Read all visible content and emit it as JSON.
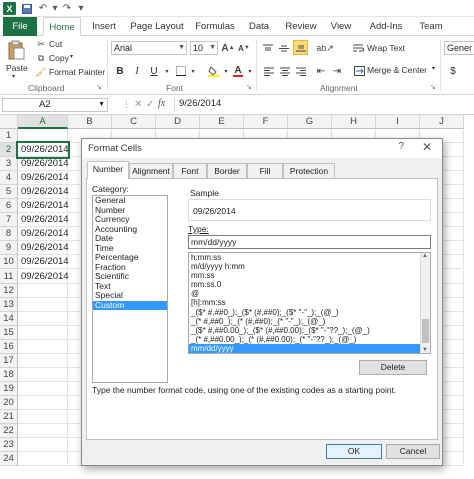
{
  "qat": {
    "logo": "X",
    "save_icon": "save-icon",
    "undo_icon": "undo-icon",
    "redo_icon": "redo-icon",
    "customize_icon": "customize-qat-icon"
  },
  "tabs": [
    "File",
    "Home",
    "Insert",
    "Page Layout",
    "Formulas",
    "Data",
    "Review",
    "View",
    "Add-Ins",
    "Team"
  ],
  "active_tab": "Home",
  "ribbon": {
    "clipboard": {
      "paste": "Paste",
      "cut": "Cut",
      "copy": "Copy",
      "format_painter": "Format Painter",
      "group_label": "Clipboard"
    },
    "font": {
      "font_name": "Arial",
      "font_size": "10",
      "group_label": "Font"
    },
    "alignment": {
      "wrap_text": "Wrap Text",
      "merge_center": "Merge & Center",
      "group_label": "Alignment"
    },
    "number": {
      "format": "Gener"
    }
  },
  "formula_bar": {
    "name_box": "A2",
    "fx": "fx",
    "value": "9/26/2014"
  },
  "grid": {
    "columns": [
      "A",
      "B",
      "C",
      "D",
      "E",
      "F",
      "G",
      "H",
      "I",
      "J"
    ],
    "rows": [
      "1",
      "2",
      "3",
      "4",
      "5",
      "6",
      "7",
      "8",
      "9",
      "10",
      "11",
      "12",
      "13",
      "14",
      "15",
      "16",
      "17",
      "18",
      "19",
      "20",
      "21",
      "22",
      "23",
      "24"
    ],
    "column_a_values": [
      "",
      "09/26/2014",
      "09/26/2014",
      "09/26/2014",
      "09/26/2014",
      "09/26/2014",
      "09/26/2014",
      "09/26/2014",
      "09/26/2014",
      "09/26/2014",
      "09/26/2014"
    ]
  },
  "dialog": {
    "title": "Format Cells",
    "help": "?",
    "close": "✕",
    "tabs": [
      "Number",
      "Alignment",
      "Font",
      "Border",
      "Fill",
      "Protection"
    ],
    "active_tab": "Number",
    "category_label": "Category:",
    "categories": [
      "General",
      "Number",
      "Currency",
      "Accounting",
      "Date",
      "Time",
      "Percentage",
      "Fraction",
      "Scientific",
      "Text",
      "Special",
      "Custom"
    ],
    "selected_category": "Custom",
    "sample_label": "Sample",
    "sample_value": "09/26/2014",
    "type_label": "Type:",
    "type_value": "mm/dd/yyyy",
    "codes": [
      "h:mm:ss",
      "m/d/yyyy h:mm",
      "mm:ss",
      "mm:ss.0",
      "@",
      "[h]:mm:ss",
      "_($* #,##0_);_($* (#,##0);_($* \"-\"_);_(@_)",
      "_(* #,##0_);_(* (#,##0);_(* \"-\"_);_(@_)",
      "_($* #,##0.00_);_($* (#,##0.00);_($* \"-\"??_);_(@_)",
      "_(* #,##0.00_);_(* (#,##0.00);_(* \"-\"??_);_(@_)",
      "mm/dd/yyyy"
    ],
    "selected_code": "mm/dd/yyyy",
    "delete_label": "Delete",
    "hint": "Type the number format code, using one of the existing codes as a starting point.",
    "ok_label": "OK",
    "cancel_label": "Cancel"
  },
  "colors": {
    "excel_green": "#1e7145",
    "selection_blue": "#3399ff"
  }
}
